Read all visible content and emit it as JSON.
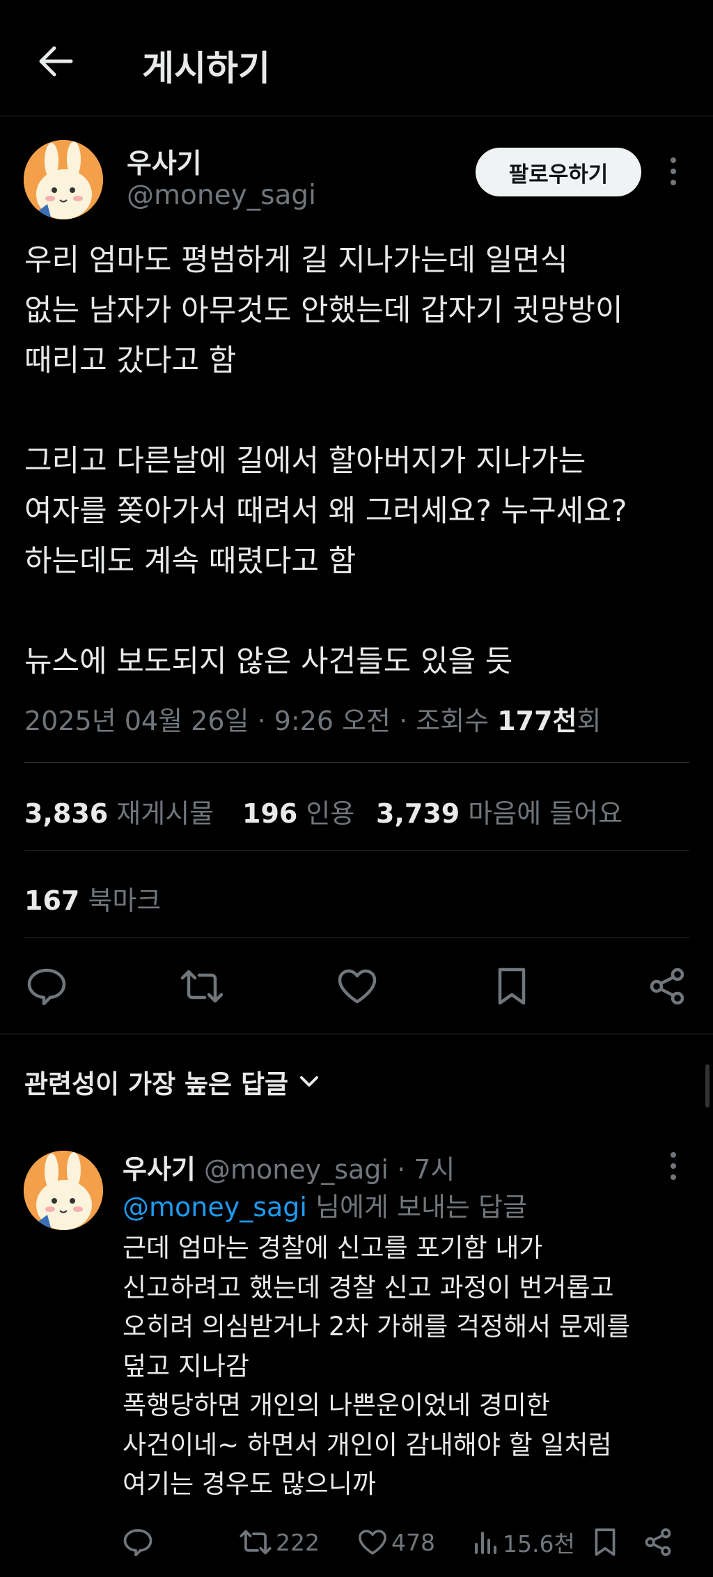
{
  "header": {
    "title": "게시하기"
  },
  "post": {
    "author_name": "우사기",
    "author_handle": "@money_sagi",
    "follow_label": "팔로우하기",
    "paragraphs": [
      "우리 엄마도 평범하게 길 지나가는데 일면식\n없는 남자가 아무것도 안했는데 갑자기 귓망방이\n때리고 갔다고 함",
      "그리고 다른날에 길에서 할아버지가 지나가는\n여자를 쫒아가서 때려서 왜 그러세요? 누구세요?\n하는데도 계속 때렸다고 함",
      "뉴스에 보도되지 않은 사건들도 있을 듯"
    ],
    "meta_date": "2025년 04월 26일 · 9:26 오전 · 조회수 ",
    "meta_views": "177천",
    "meta_views_suffix": "회",
    "stats": {
      "reposts_count": "3,836",
      "reposts_label": "재게시물",
      "quotes_count": "196",
      "quotes_label": "인용",
      "likes_count": "3,739",
      "likes_label": "마음에 들어요",
      "bookmarks_count": "167",
      "bookmarks_label": "북마크"
    }
  },
  "replies_sort": {
    "label": "관련성이 가장 높은 답글"
  },
  "reply": {
    "author_name": "우사기",
    "author_handle": "@money_sagi",
    "time": "· 7시",
    "reply_to_mention": "@money_sagi",
    "reply_to_suffix": " 님에게 보내는 답글",
    "text": "근데 엄마는 경찰에 신고를 포기함 내가\n신고하려고 했는데 경찰 신고 과정이 번거롭고\n오히려 의심받거나 2차 가해를 걱정해서 문제를\n덮고 지나감\n폭행당하면 개인의 나쁜운이었네 경미한\n사건이네~ 하면서 개인이 감내해야 할 일처럼\n여기는 경우도 많으니까",
    "reposts": "222",
    "likes": "478",
    "views": "15.6천"
  },
  "colors": {
    "background": "#000000",
    "text": "#e7e9ea",
    "muted": "#71767b",
    "link": "#1d9bf0",
    "divider": "#2f3336"
  }
}
